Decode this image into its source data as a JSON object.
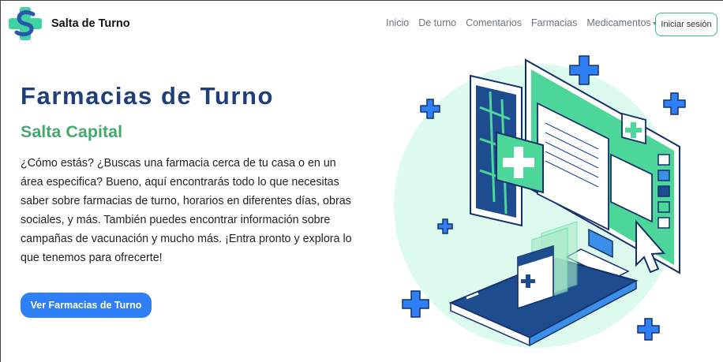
{
  "brand": {
    "name": "Salta de Turno",
    "logo_icon": "s-cross-logo-icon"
  },
  "nav": {
    "links": [
      "Inicio",
      "De turno",
      "Comentarios",
      "Farmacias",
      "Medicamentos"
    ],
    "login": "Iniciar sesión"
  },
  "hero": {
    "title": "Farmacias de Turno",
    "subtitle": "Salta Capital",
    "description": "¿Cómo estás? ¿Buscas una farmacia cerca de tu casa o en un área especifica? Bueno, aquí encontrarás todo lo que necesitas saber sobre farmacias de turno, horarios en diferentes días, obras sociales, y más. También puedes encontrar información sobre campañas de vacunación y mucho más. ¡Entra pronto y explora lo que tenemos para ofrecerte!",
    "cta": "Ver Farmacias de Turno"
  },
  "colors": {
    "title": "#1e3f7a",
    "subtitle": "#46a86d",
    "cta_bg": "#2f7ff6",
    "accent_green": "#4cd69a",
    "accent_blue": "#2f7ff6"
  }
}
